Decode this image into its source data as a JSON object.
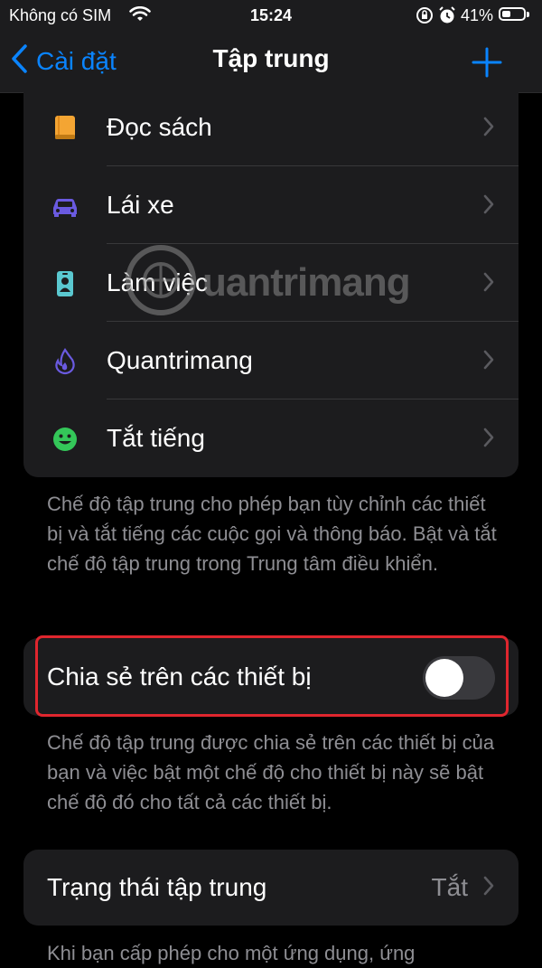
{
  "status_bar": {
    "carrier": "Không có SIM",
    "time": "15:24",
    "battery_percent": "41%",
    "battery_level": 0.41
  },
  "nav": {
    "back_label": "Cài đặt",
    "title": "Tập trung"
  },
  "focus_modes": [
    {
      "label": "Đọc sách",
      "icon": "book-icon",
      "color": "#f4a533"
    },
    {
      "label": "Lái xe",
      "icon": "car-icon",
      "color": "#6a5ae0"
    },
    {
      "label": "Làm việc",
      "icon": "id-badge-icon",
      "color": "#5ac8d0"
    },
    {
      "label": "Quantrimang",
      "icon": "flame-icon",
      "color": "#6a5ae0"
    },
    {
      "label": "Tắt tiếng",
      "icon": "smiley-icon",
      "color": "#34c759"
    }
  ],
  "focus_footer": "Chế độ tập trung cho phép bạn tùy chỉnh các thiết bị và tắt tiếng các cuộc gọi và thông báo. Bật và tắt chế độ tập trung trong Trung tâm điều khiển.",
  "share_setting": {
    "label": "Chia sẻ trên các thiết bị",
    "enabled": false
  },
  "share_footer": "Chế độ tập trung được chia sẻ trên các thiết bị của bạn và việc bật một chế độ cho thiết bị này sẽ bật chế độ đó cho tất cả các thiết bị.",
  "focus_status": {
    "label": "Trạng thái tập trung",
    "value": "Tắt"
  },
  "bottom_footer": "Khi bạn cấp phép cho một ứng dụng, ứng",
  "watermark": "uantrimang",
  "colors": {
    "accent": "#0a84ff",
    "highlight_border": "#e0262e"
  }
}
